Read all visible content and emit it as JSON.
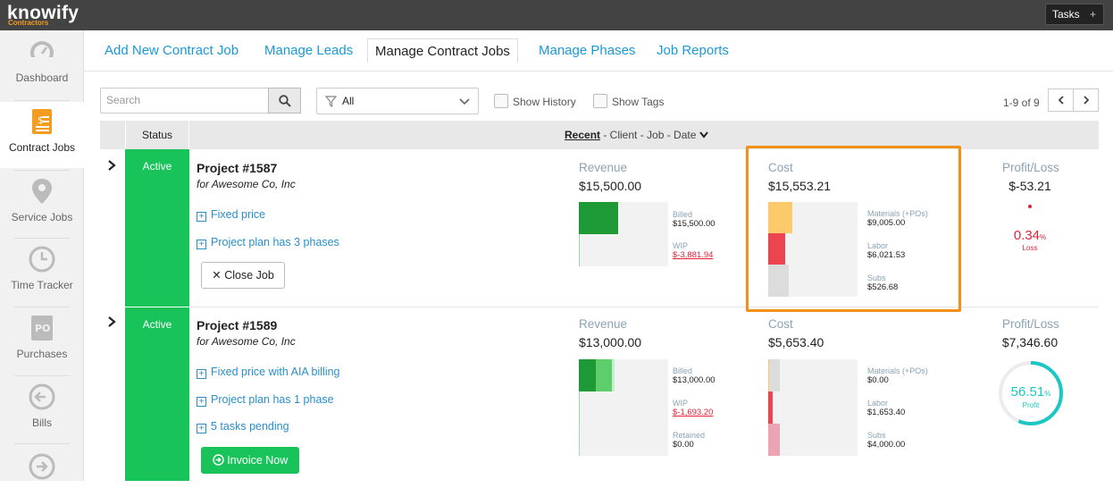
{
  "topbar": {
    "logo": "knowify",
    "logo_sub": "Contractors",
    "tasks_label": "Tasks",
    "tasks_plus": "+"
  },
  "sidebar": {
    "items": [
      {
        "label": "Dashboard",
        "icon": "gauge-icon"
      },
      {
        "label": "Contract Jobs",
        "icon": "contract-document-icon"
      },
      {
        "label": "Service Jobs",
        "icon": "map-pin-icon"
      },
      {
        "label": "Time Tracker",
        "icon": "clock-icon"
      },
      {
        "label": "Purchases",
        "icon": "po-document-icon"
      },
      {
        "label": "Bills",
        "icon": "arrow-left-circle-icon"
      }
    ]
  },
  "tabs": [
    "Add New Contract Job",
    "Manage Leads",
    "Manage Contract Jobs",
    "Manage Phases",
    "Job Reports"
  ],
  "toolbar": {
    "search_placeholder": "Search",
    "filter_value": "All",
    "show_history": "Show History",
    "show_tags": "Show Tags",
    "pager": "1-9 of 9"
  },
  "table": {
    "status_header": "Status",
    "sort_active": "Recent",
    "sort_rest": " - Client - Job - Date"
  },
  "colors": {
    "accent": "#1a9ad6",
    "active_status": "#18c35a",
    "highlight": "#f29017",
    "loss": "#e3213a",
    "profit_ring": "#1cc6c4"
  },
  "jobs": [
    {
      "status": "Active",
      "project": "Project #1587",
      "client": "for Awesome Co, Inc",
      "links": [
        "Fixed price",
        "Project plan has 3 phases"
      ],
      "action": "Close Job",
      "revenue": {
        "label": "Revenue",
        "value": "$15,500.00",
        "items": [
          {
            "label": "Billed",
            "value": "$15,500.00"
          },
          {
            "label": "WIP",
            "value": "$-3,881.94"
          }
        ]
      },
      "cost": {
        "label": "Cost",
        "value": "$15,553.21",
        "items": [
          {
            "label": "Materials (+POs)",
            "value": "$9,005.00"
          },
          {
            "label": "Labor",
            "value": "$6,021.53"
          },
          {
            "label": "Subs",
            "value": "$526.68"
          }
        ]
      },
      "profit": {
        "label": "Profit/Loss",
        "value": "$-53.21",
        "percent": "0.34",
        "unit": "%",
        "kind": "Loss"
      }
    },
    {
      "status": "Active",
      "project": "Project #1589",
      "client": "for Awesome Co, Inc",
      "links": [
        "Fixed price with AIA billing",
        "Project plan has 1 phase",
        "5 tasks pending"
      ],
      "action": "Invoice Now",
      "revenue": {
        "label": "Revenue",
        "value": "$13,000.00",
        "items": [
          {
            "label": "Billed",
            "value": "$13,000.00"
          },
          {
            "label": "WIP",
            "value": "$-1,693.20"
          },
          {
            "label": "Retained",
            "value": "$0.00"
          }
        ]
      },
      "cost": {
        "label": "Cost",
        "value": "$5,653.40",
        "items": [
          {
            "label": "Materials (+POs)",
            "value": "$0.00"
          },
          {
            "label": "Labor",
            "value": "$1,653.40"
          },
          {
            "label": "Subs",
            "value": "$4,000.00"
          }
        ]
      },
      "profit": {
        "label": "Profit/Loss",
        "value": "$7,346.60",
        "percent": "56.51",
        "unit": "%",
        "kind": "Profit",
        "ring_fraction": 0.5651
      }
    }
  ]
}
